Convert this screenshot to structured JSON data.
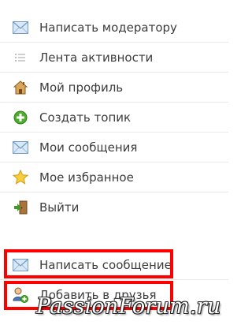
{
  "menu": {
    "items": [
      {
        "label": "Написать модератору",
        "icon": "envelope-icon"
      },
      {
        "label": "Лента активности",
        "icon": "activity-list-icon"
      },
      {
        "label": "Мой профиль",
        "icon": "home-profile-icon"
      },
      {
        "label": "Создать топик",
        "icon": "plus-circle-icon"
      },
      {
        "label": "Мои сообщения",
        "icon": "envelope-icon"
      },
      {
        "label": "Мое избранное",
        "icon": "star-icon"
      },
      {
        "label": "Выйти",
        "icon": "exit-door-icon"
      }
    ]
  },
  "actions": {
    "items": [
      {
        "label": "Написать сообщение",
        "icon": "envelope-icon"
      },
      {
        "label": "Добавить в друзья",
        "icon": "add-user-icon"
      }
    ]
  },
  "highlight_color": "#ff0000",
  "watermark": {
    "text": "PassionForum.ru"
  }
}
